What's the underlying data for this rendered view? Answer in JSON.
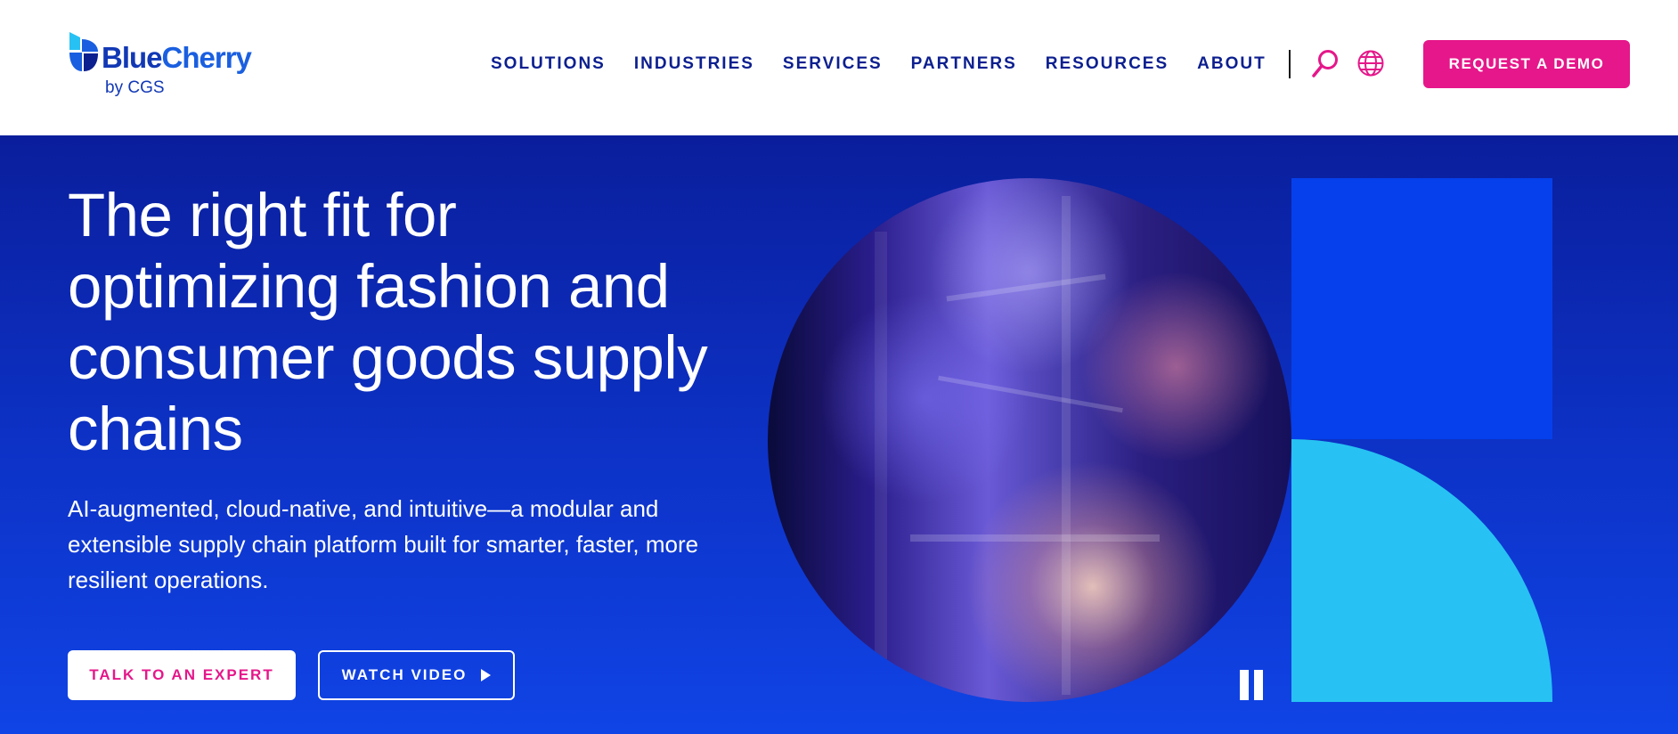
{
  "brand": {
    "name_part1": "Blue",
    "name_part2": "Cherry",
    "tagline": "by CGS"
  },
  "nav": {
    "items": [
      {
        "label": "SOLUTIONS"
      },
      {
        "label": "INDUSTRIES"
      },
      {
        "label": "SERVICES"
      },
      {
        "label": "PARTNERS"
      },
      {
        "label": "RESOURCES"
      },
      {
        "label": "ABOUT"
      }
    ],
    "search_icon": "search-icon",
    "globe_icon": "globe-icon",
    "cta_label": "REQUEST A DEMO"
  },
  "hero": {
    "title": "The right fit for optimizing fashion and consumer goods supply chains",
    "subtitle": "AI-augmented, cloud-native, and intuitive—a modular and extensible supply chain platform built for smarter, faster, more resilient operations.",
    "primary_cta": "TALK TO AN EXPERT",
    "secondary_cta": "WATCH VIDEO",
    "play_icon": "play-icon",
    "pause_icon": "pause-icon"
  },
  "colors": {
    "accent_pink": "#e5178a",
    "navy": "#0c1f8f",
    "hero_blue": "#0d33c8",
    "shape_blue": "#0540ec",
    "shape_cyan": "#27c2f3"
  }
}
